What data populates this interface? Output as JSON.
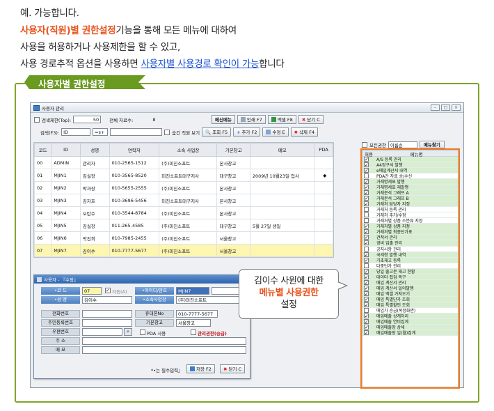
{
  "intro": {
    "line1": "예. 가능합니다.",
    "line2_red": "사용자(직원)별 권한설정",
    "line2_rest": "기능을 통해 모든 메뉴에 대하여",
    "line3": "사용을 허용하거나 사용제한을 할 수 있고,",
    "line4_pre": "사용 경로추적 옵션을 사용하면 ",
    "line4_link": "사용자별 사용경로 확인이 가능",
    "line4_post": "합니다"
  },
  "section_tag": "사용자별 권한설정",
  "window": {
    "title": "사용자 관리",
    "search_top_label": "검색제한(Top):",
    "search_top_value": "50",
    "total_label": "전체 자료수:",
    "total_value": "8",
    "btn_tab": "메신메뉴",
    "btn_print": "인쇄 F7",
    "btn_excel": "엑셀 F8",
    "btn_close": "닫기 C",
    "search_key_label": "검색(F3):",
    "search_key_value": "ID",
    "search_op_value": "=s+",
    "hide_retired_label": "숨긴 직원 보기",
    "btn_search": "조회 F5",
    "btn_add": "추가 F2",
    "btn_edit": "수정 E",
    "btn_delete": "삭제 F4",
    "columns": [
      "코드",
      "ID",
      "성명",
      "연락처",
      "소속 사업장",
      "기본창고",
      "메모",
      "PDA"
    ],
    "rows": [
      {
        "code": "00",
        "id": "ADMIN",
        "name": "관리자",
        "phone": "010-2565-1512",
        "site": "(주)미진소프트",
        "wh": "본사창고",
        "memo": "",
        "pda": ""
      },
      {
        "code": "01",
        "id": "MJIN1",
        "name": "김실장",
        "phone": "010-3565-8520",
        "site": "미진소프트대구지사",
        "wh": "대구창고",
        "memo": "2009년 10월23일 입사",
        "pda": "◆"
      },
      {
        "code": "02",
        "id": "MJIN2",
        "name": "박과장",
        "phone": "010-5655-2555",
        "site": "(주)미진소프트",
        "wh": "본사창고",
        "memo": "",
        "pda": ""
      },
      {
        "code": "03",
        "id": "MJIN3",
        "name": "김차호",
        "phone": "010-3696-5456",
        "site": "미진소프트대구지사",
        "wh": "본사창고",
        "memo": "",
        "pda": ""
      },
      {
        "code": "04",
        "id": "MJIN4",
        "name": "오탄수",
        "phone": "010-3544-8784",
        "site": "(주)미진소프트",
        "wh": "본사창고",
        "memo": "",
        "pda": ""
      },
      {
        "code": "05",
        "id": "MJIN5",
        "name": "김실장",
        "phone": "011-265-4585",
        "site": "(주)미진소프트",
        "wh": "대구창고",
        "memo": "5월 27일 생일",
        "pda": ""
      },
      {
        "code": "06",
        "id": "MJIN6",
        "name": "박진희",
        "phone": "010-7985-2455",
        "site": "(주)미진소프트",
        "wh": "서울창고",
        "memo": "",
        "pda": ""
      },
      {
        "code": "07",
        "id": "MJIN7",
        "name": "김이수",
        "phone": "010-7777-5677",
        "site": "(주)미진소프트",
        "wh": "서울창고",
        "memo": "",
        "pda": ""
      }
    ],
    "all_perm_label": "모든권한",
    "all_perm_select": "이름순",
    "btn_menu_find": "메뉴찾기",
    "menu_header_allow": "허용",
    "menu_header_name": "메뉴명",
    "menus": [
      {
        "name": "A/S 등록 관리",
        "on": true
      },
      {
        "name": "A4정구서 발행",
        "on": true
      },
      {
        "name": "e메일계산서 내역",
        "on": true
      },
      {
        "name": "PDA간 자료 송/수신",
        "on": false
      },
      {
        "name": "거래명세표 발행",
        "on": true
      },
      {
        "name": "거래명세표 재발행",
        "on": true
      },
      {
        "name": "거래분석 그래프 A",
        "on": true
      },
      {
        "name": "거래분석 그래프 B",
        "on": true
      },
      {
        "name": "거래처 담당자 지정",
        "on": true
      },
      {
        "name": "거래처 등록 관리",
        "on": false
      },
      {
        "name": "거래처 추가/수정",
        "on": false
      },
      {
        "name": "거래처별 상품 소분류 지정",
        "on": false
      },
      {
        "name": "거래처별 상품 지정",
        "on": true
      },
      {
        "name": "거래처별 최종단가표",
        "on": true
      },
      {
        "name": "견적서 관리",
        "on": true
      },
      {
        "name": "경비 입출 관리",
        "on": true
      },
      {
        "name": "공지사항 관리",
        "on": false
      },
      {
        "name": "국세청 발행 내역",
        "on": true
      },
      {
        "name": "기초재고 등록",
        "on": true
      },
      {
        "name": "다중단가 관리",
        "on": false
      },
      {
        "name": "당일 출고분 재고 현황",
        "on": true
      },
      {
        "name": "데이터 접검 복구",
        "on": true
      },
      {
        "name": "매입 계산서 관리",
        "on": true
      },
      {
        "name": "매입 계산서 일의발행",
        "on": true
      },
      {
        "name": "매입 엑셀 가져오기",
        "on": true
      },
      {
        "name": "매입 특별단가 조회",
        "on": true
      },
      {
        "name": "매입 특별할인 조회",
        "on": true
      },
      {
        "name": "매입가 승급(목정화면)",
        "on": false
      },
      {
        "name": "매입매출 상계처리",
        "on": true
      },
      {
        "name": "매입매출 연비집계",
        "on": true
      },
      {
        "name": "매입매출장 상세",
        "on": true
      },
      {
        "name": "매입매출장 일(월)집계",
        "on": true
      }
    ]
  },
  "dialog": {
    "title": "사용자 - 『수정』",
    "code_label": "•코  드",
    "code_value": "07",
    "autonum_label": "자동(A)",
    "idpw_label": "•아이디/암호",
    "id_value": "MJIN7",
    "name_label": "•성  명",
    "name_value": "김이수",
    "site_label": "•소속사업장",
    "site_value": "(주)미진소프트",
    "phone_label": "전화번호",
    "mobile_label": "휴대폰No",
    "mobile_value": "010-7777-5677",
    "rrn_label": "주민등록번호",
    "wh_label": "기본창고",
    "wh_value": "서울창고",
    "zip_label": "우편번호",
    "pda_label": "PDA 사용",
    "admin_label": "관리권한(승급)",
    "addr_label": "주  소",
    "memo_label": "메  모",
    "required_note": "*•는 필수입력』",
    "btn_save": "저장 F2",
    "btn_close": "닫기 C"
  },
  "callout": {
    "line1": "김이수 사원에 대한",
    "line2": "메뉴별 사용권한",
    "line3": "설정"
  },
  "colors": {
    "accent_red": "#e8541e",
    "green": "#6a9a1f",
    "orange": "#f07b1e",
    "link": "#1a4fd1"
  }
}
